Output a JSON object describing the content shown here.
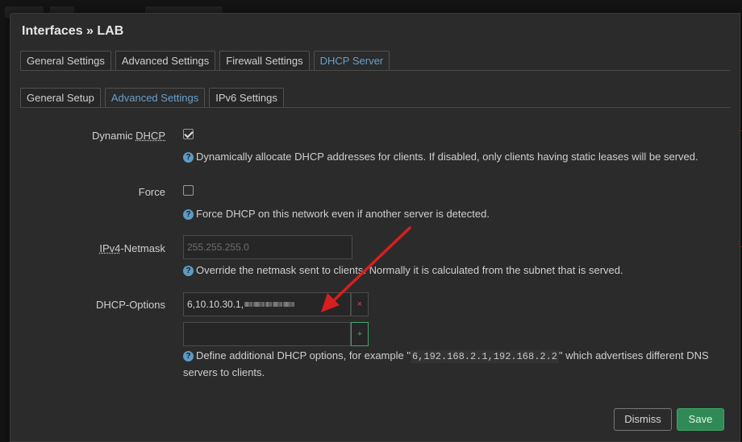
{
  "modal": {
    "title": "Interfaces » LAB"
  },
  "tabs_main": [
    {
      "label": "General Settings",
      "active": false
    },
    {
      "label": "Advanced Settings",
      "active": false
    },
    {
      "label": "Firewall Settings",
      "active": false
    },
    {
      "label": "DHCP Server",
      "active": true
    }
  ],
  "tabs_sub": [
    {
      "label": "General Setup",
      "active": false
    },
    {
      "label": "Advanced Settings",
      "active": true
    },
    {
      "label": "IPv6 Settings",
      "active": false
    }
  ],
  "dynamic_dhcp": {
    "label_prefix": "Dynamic ",
    "label_abbr": "DHCP",
    "checked": true,
    "help": "Dynamically allocate DHCP addresses for clients. If disabled, only clients having static leases will be served."
  },
  "force": {
    "label": "Force",
    "checked": false,
    "help": "Force DHCP on this network even if another server is detected."
  },
  "ipv4_netmask": {
    "label_abbr": "IPv4",
    "label_suffix": "-Netmask",
    "placeholder": "255.255.255.0",
    "value": "",
    "help": "Override the netmask sent to clients. Normally it is calculated from the subnet that is served."
  },
  "dhcp_options": {
    "label": "DHCP-Options",
    "entries": [
      "6,10.10.30.1,"
    ],
    "new_value": "",
    "remove_label": "×",
    "add_label": "+",
    "help_before": "Define additional DHCP options, for example \"",
    "help_code": "6,192.168.2.1,192.168.2.2",
    "help_after": "\" which advertises different DNS servers to clients."
  },
  "help_icon_glyph": "?",
  "footer": {
    "dismiss_label": "Dismiss",
    "save_label": "Save"
  },
  "colors": {
    "accent": "#5b9bc5",
    "save": "#2f8a55",
    "arrow": "#d81e1e"
  }
}
